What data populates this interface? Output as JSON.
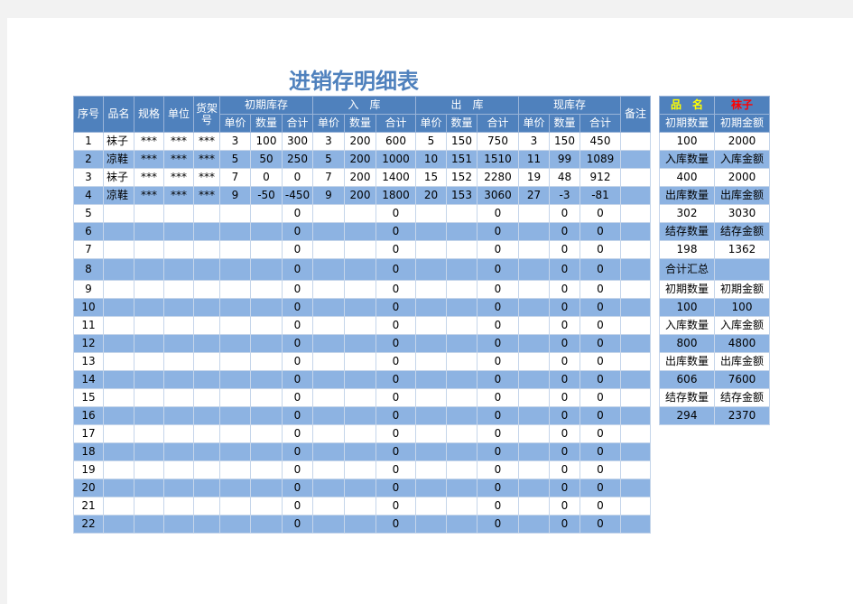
{
  "title": "进销存明细表",
  "headers": {
    "seq": "序号",
    "name": "品名",
    "spec": "规格",
    "unit": "单位",
    "shelf": "货架号",
    "opening": "初期库存",
    "inbound": "入　库",
    "outbound": "出　库",
    "current": "现库存",
    "remark": "备注",
    "price": "单价",
    "qty": "数量",
    "total": "合计"
  },
  "rows": [
    [
      "1",
      "袜子",
      "***",
      "***",
      "***",
      "3",
      "100",
      "300",
      "3",
      "200",
      "600",
      "5",
      "150",
      "750",
      "3",
      "150",
      "450",
      ""
    ],
    [
      "2",
      "凉鞋",
      "***",
      "***",
      "***",
      "5",
      "50",
      "250",
      "5",
      "200",
      "1000",
      "10",
      "151",
      "1510",
      "11",
      "99",
      "1089",
      ""
    ],
    [
      "3",
      "袜子",
      "***",
      "***",
      "***",
      "7",
      "0",
      "0",
      "7",
      "200",
      "1400",
      "15",
      "152",
      "2280",
      "19",
      "48",
      "912",
      ""
    ],
    [
      "4",
      "凉鞋",
      "***",
      "***",
      "***",
      "9",
      "-50",
      "-450",
      "9",
      "200",
      "1800",
      "20",
      "153",
      "3060",
      "27",
      "-3",
      "-81",
      ""
    ],
    [
      "5",
      "",
      "",
      "",
      "",
      "",
      "",
      "0",
      "",
      "",
      "0",
      "",
      "",
      "0",
      "",
      "0",
      "0",
      ""
    ],
    [
      "6",
      "",
      "",
      "",
      "",
      "",
      "",
      "0",
      "",
      "",
      "0",
      "",
      "",
      "0",
      "",
      "0",
      "0",
      ""
    ],
    [
      "7",
      "",
      "",
      "",
      "",
      "",
      "",
      "0",
      "",
      "",
      "0",
      "",
      "",
      "0",
      "",
      "0",
      "0",
      ""
    ],
    [
      "8",
      "",
      "",
      "",
      "",
      "",
      "",
      "0",
      "",
      "",
      "0",
      "",
      "",
      "0",
      "",
      "0",
      "0",
      ""
    ],
    [
      "9",
      "",
      "",
      "",
      "",
      "",
      "",
      "0",
      "",
      "",
      "0",
      "",
      "",
      "0",
      "",
      "0",
      "0",
      ""
    ],
    [
      "10",
      "",
      "",
      "",
      "",
      "",
      "",
      "0",
      "",
      "",
      "0",
      "",
      "",
      "0",
      "",
      "0",
      "0",
      ""
    ],
    [
      "11",
      "",
      "",
      "",
      "",
      "",
      "",
      "0",
      "",
      "",
      "0",
      "",
      "",
      "0",
      "",
      "0",
      "0",
      ""
    ],
    [
      "12",
      "",
      "",
      "",
      "",
      "",
      "",
      "0",
      "",
      "",
      "0",
      "",
      "",
      "0",
      "",
      "0",
      "0",
      ""
    ],
    [
      "13",
      "",
      "",
      "",
      "",
      "",
      "",
      "0",
      "",
      "",
      "0",
      "",
      "",
      "0",
      "",
      "0",
      "0",
      ""
    ],
    [
      "14",
      "",
      "",
      "",
      "",
      "",
      "",
      "0",
      "",
      "",
      "0",
      "",
      "",
      "0",
      "",
      "0",
      "0",
      ""
    ],
    [
      "15",
      "",
      "",
      "",
      "",
      "",
      "",
      "0",
      "",
      "",
      "0",
      "",
      "",
      "0",
      "",
      "0",
      "0",
      ""
    ],
    [
      "16",
      "",
      "",
      "",
      "",
      "",
      "",
      "0",
      "",
      "",
      "0",
      "",
      "",
      "0",
      "",
      "0",
      "0",
      ""
    ],
    [
      "17",
      "",
      "",
      "",
      "",
      "",
      "",
      "0",
      "",
      "",
      "0",
      "",
      "",
      "0",
      "",
      "0",
      "0",
      ""
    ],
    [
      "18",
      "",
      "",
      "",
      "",
      "",
      "",
      "0",
      "",
      "",
      "0",
      "",
      "",
      "0",
      "",
      "0",
      "0",
      ""
    ],
    [
      "19",
      "",
      "",
      "",
      "",
      "",
      "",
      "0",
      "",
      "",
      "0",
      "",
      "",
      "0",
      "",
      "0",
      "0",
      ""
    ],
    [
      "20",
      "",
      "",
      "",
      "",
      "",
      "",
      "0",
      "",
      "",
      "0",
      "",
      "",
      "0",
      "",
      "0",
      "0",
      ""
    ],
    [
      "21",
      "",
      "",
      "",
      "",
      "",
      "",
      "0",
      "",
      "",
      "0",
      "",
      "",
      "0",
      "",
      "0",
      "0",
      ""
    ],
    [
      "22",
      "",
      "",
      "",
      "",
      "",
      "",
      "0",
      "",
      "",
      "0",
      "",
      "",
      "0",
      "",
      "0",
      "0",
      ""
    ]
  ],
  "summary": {
    "name_label": "品　名",
    "name_value": "袜子",
    "rows": [
      [
        "初期数量",
        "初期金额"
      ],
      [
        "100",
        "2000"
      ],
      [
        "入库数量",
        "入库金额"
      ],
      [
        "400",
        "2000"
      ],
      [
        "出库数量",
        "出库金额"
      ],
      [
        "302",
        "3030"
      ],
      [
        "结存数量",
        "结存金额"
      ],
      [
        "198",
        "1362"
      ],
      [
        "合计汇总",
        ""
      ],
      [
        "初期数量",
        "初期金额"
      ],
      [
        "100",
        "100"
      ],
      [
        "入库数量",
        "入库金额"
      ],
      [
        "800",
        "4800"
      ],
      [
        "出库数量",
        "出库金额"
      ],
      [
        "606",
        "7600"
      ],
      [
        "结存数量",
        "结存金额"
      ],
      [
        "294",
        "2370"
      ]
    ]
  },
  "colors": {
    "header": "#4f81bd",
    "band": "#8db3e2",
    "title": "#4f81bd"
  }
}
